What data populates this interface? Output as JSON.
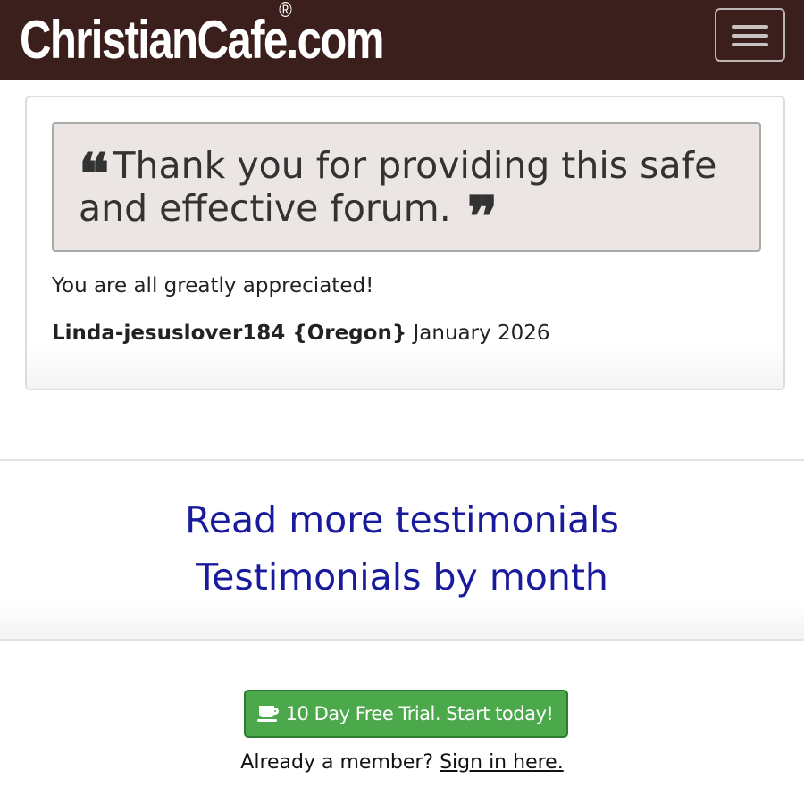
{
  "header": {
    "brand": "ChristianCafe.com",
    "registered_mark": "®",
    "menu_icon": "hamburger-menu-icon"
  },
  "testimonial": {
    "open_quote": "❝",
    "quote": "Thank you for providing this safe and effective forum.",
    "close_quote": "❞",
    "message": "You are all greatly appreciated!",
    "author": "Linda-jesuslover184 {Oregon}",
    "date": "January 2026"
  },
  "links": {
    "read_more": "Read more testimonials",
    "by_month": "Testimonials by month"
  },
  "cta": {
    "icon": "coffee-cup-icon",
    "label": "10 Day Free Trial. Start today!",
    "member_prompt": "Already a member?",
    "sign_in": "Sign in here."
  },
  "colors": {
    "navbar": "#3b1f1c",
    "link": "#1a1a9c",
    "cta": "#4ba84b"
  }
}
